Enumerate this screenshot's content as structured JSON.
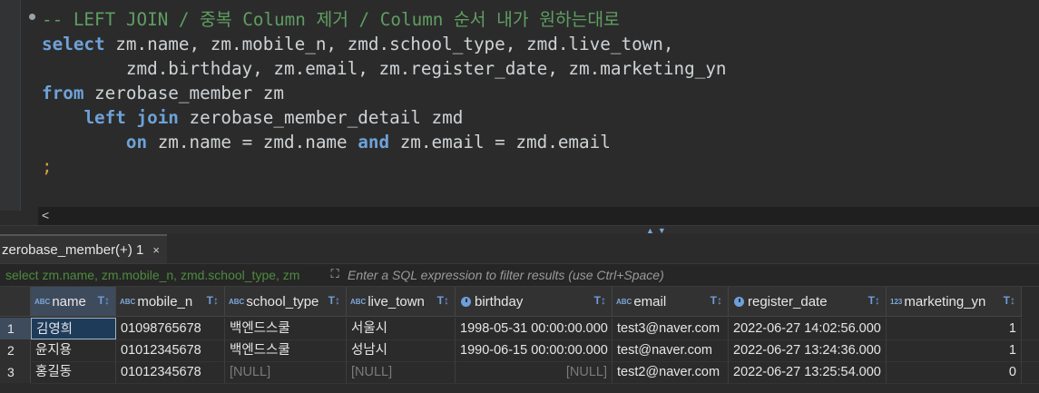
{
  "editor": {
    "lines": [
      [
        {
          "t": "-- LEFT JOIN / 중복 Column 제거 / Column 순서 내가 원하는대로",
          "c": "cm"
        }
      ],
      [
        {
          "t": "select",
          "c": "kw"
        },
        {
          "t": " zm.name, zm.mobile_n, zmd.school_type, zmd.live_town,",
          "c": "pl"
        }
      ],
      [
        {
          "t": "        zmd.birthday, zm.email, zm.register_date, zm.marketing_yn",
          "c": "pl"
        }
      ],
      [
        {
          "t": "from",
          "c": "kw"
        },
        {
          "t": " zerobase_member zm",
          "c": "pl"
        }
      ],
      [
        {
          "t": "    ",
          "c": "pl"
        },
        {
          "t": "left join",
          "c": "kw"
        },
        {
          "t": " zerobase_member_detail zmd",
          "c": "pl"
        }
      ],
      [
        {
          "t": "        ",
          "c": "pl"
        },
        {
          "t": "on",
          "c": "kw"
        },
        {
          "t": " zm.name = zmd.name ",
          "c": "pl"
        },
        {
          "t": "and",
          "c": "kw"
        },
        {
          "t": " zm.email = zmd.email",
          "c": "pl"
        }
      ],
      [
        {
          "t": ";",
          "c": "semi"
        }
      ]
    ],
    "scroll_left": "<"
  },
  "results_tab": {
    "label": "zerobase_member(+) 1",
    "close": "×"
  },
  "filter": {
    "query_text": "select zm.name, zm.mobile_n, zmd.school_type, zm",
    "placeholder": "Enter a SQL expression to filter results (use Ctrl+Space)"
  },
  "grid": {
    "columns": [
      {
        "name": "name",
        "type": "ABC"
      },
      {
        "name": "mobile_n",
        "type": "ABC"
      },
      {
        "name": "school_type",
        "type": "ABC"
      },
      {
        "name": "live_town",
        "type": "ABC"
      },
      {
        "name": "birthday",
        "type": "clock"
      },
      {
        "name": "email",
        "type": "ABC"
      },
      {
        "name": "register_date",
        "type": "clock"
      },
      {
        "name": "marketing_yn",
        "type": "123"
      }
    ],
    "rows": [
      {
        "num": "1",
        "cells": [
          "김영희",
          "01098765678",
          "백엔드스쿨",
          "서울시",
          "1998-05-31 00:00:00.000",
          "test3@naver.com",
          "2022-06-27 14:02:56.000",
          "1"
        ]
      },
      {
        "num": "2",
        "cells": [
          "윤지용",
          "01012345678",
          "백엔드스쿨",
          "성남시",
          "1990-06-15 00:00:00.000",
          "test@naver.com",
          "2022-06-27 13:24:36.000",
          "1"
        ]
      },
      {
        "num": "3",
        "cells": [
          "홍길동",
          "01012345678",
          "[NULL]",
          "[NULL]",
          "[NULL]",
          "test2@naver.com",
          "2022-06-27 13:25:54.000",
          "0"
        ]
      }
    ],
    "null_text": "[NULL]",
    "sort_icon": "T↕"
  }
}
